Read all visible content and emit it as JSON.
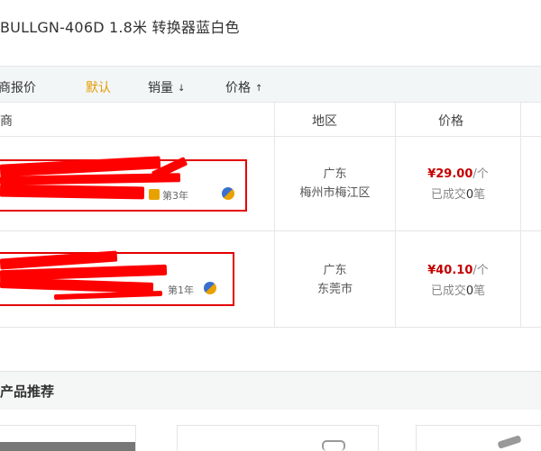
{
  "product": {
    "title": "BULLGN-406D 1.8米  转换器蓝白色"
  },
  "tabs": [
    {
      "label": "商报价"
    },
    {
      "label": "默认"
    },
    {
      "label": "销量",
      "arrow": "↓"
    },
    {
      "label": "价格",
      "arrow": "↑"
    }
  ],
  "columns": {
    "merchant": "商",
    "region": "地区",
    "price": "价格"
  },
  "rows": [
    {
      "merchant_badge": "第3年",
      "region_line1": "广东",
      "region_line2": "梅州市梅江区",
      "price": "¥29.00",
      "unit": "/个",
      "sold_prefix": "已成交",
      "sold_count": "0",
      "sold_suffix": "笔"
    },
    {
      "merchant_badge": "第1年",
      "region_line1": "广东",
      "region_line2": "东莞市",
      "price": "¥40.10",
      "unit": "/个",
      "sold_prefix": "已成交",
      "sold_count": "0",
      "sold_suffix": "笔"
    }
  ],
  "recommend": {
    "title": "产品推荐"
  },
  "colors": {
    "accent_tab": "#e59b00",
    "price": "#c40000",
    "redaction": "#ff0000"
  }
}
